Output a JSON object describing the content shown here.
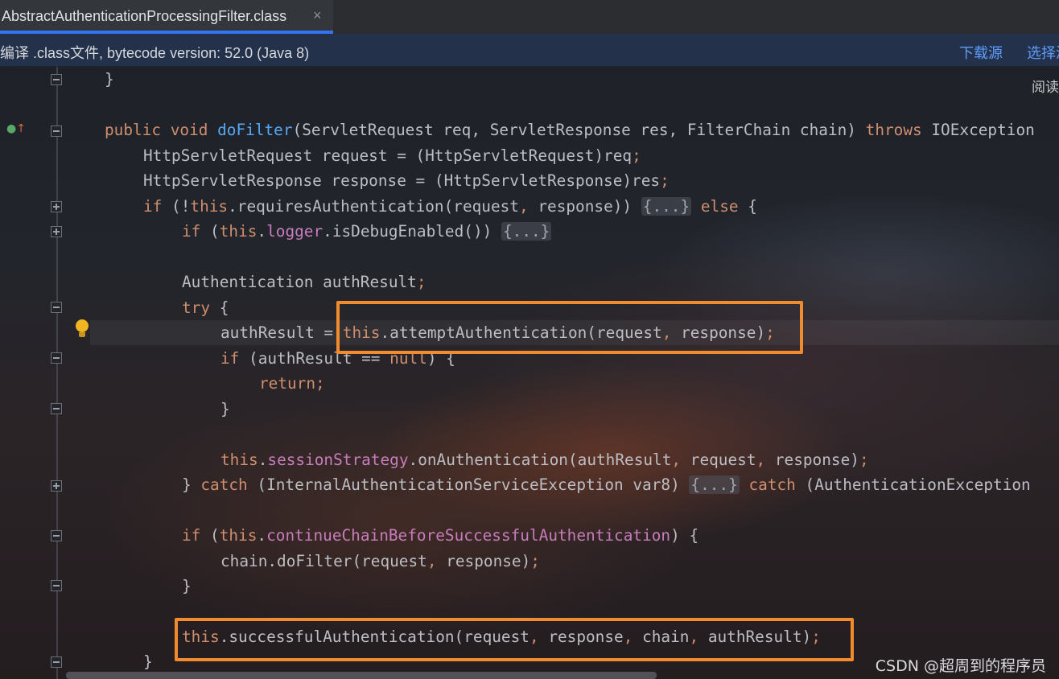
{
  "tab": {
    "title": "AbstractAuthenticationProcessingFilter.class",
    "close": "×"
  },
  "banner": {
    "text": "编译 .class文件, bytecode version: 52.0 (Java 8)",
    "download_source": "下载源",
    "choose_source": "选择源"
  },
  "editor": {
    "read_mode": "阅读"
  },
  "code": {
    "l1": "}",
    "l3_kw1": "public",
    "l3_kw2": "void",
    "l3_fn": "doFilter",
    "l3_rest": "(ServletRequest req, ServletResponse res, FilterChain chain) ",
    "l3_throws": "throws",
    "l3_tail": " IOException",
    "l4a": "HttpServletRequest request = (HttpServletRequest)req",
    "l5a": "HttpServletResponse response = (HttpServletResponse)res",
    "semi": ";",
    "comma": ",",
    "if": "if",
    "else": "else",
    "this": "this",
    "try": "try",
    "catch": "catch",
    "return": "return",
    "null": "null",
    "fold_ellipsis": "{...}",
    "l6_mid": " (!",
    "l6_call": ".requiresAuthentication(request",
    "l6_call2": " response)) ",
    "l6_end": " {",
    "l7_mid": " (",
    "l7_logger": "logger",
    "l7_call": ".isDebugEnabled()) ",
    "l9": "Authentication authResult",
    "l10_end": " {",
    "l11_pre": "authResult = ",
    "l11_call": ".attemptAuthentication(request",
    "l11_call2": " response)",
    "l12_mid": " (authResult == ",
    "l12_end": ") {",
    "l14": "}",
    "l16_field": "sessionStrategy",
    "l16_call": ".onAuthentication(authResult",
    "l16_call2": " request",
    "l16_call3": " response)",
    "l17_pre": "} ",
    "l17_mid": " (InternalAuthenticationServiceException var8) ",
    "l17_tail": " (AuthenticationException",
    "l19_mid": " (",
    "l19_field": "continueChainBeforeSuccessfulAuthentication",
    "l19_end": ") {",
    "l20_pre": "chain.doFilter(request",
    "l20_post": " response)",
    "l21": "}",
    "l23_call": ".successfulAuthentication(request",
    "l23_a": " response",
    "l23_b": " chain",
    "l23_c": " authResult)",
    "l24": "}"
  },
  "watermark": "CSDN @超周到的程序员",
  "colors": {
    "keyword": "#cf8e6d",
    "method": "#56a8f5",
    "field": "#c77dbb",
    "highlight_box": "#f08c2e",
    "link": "#5f9bff"
  }
}
